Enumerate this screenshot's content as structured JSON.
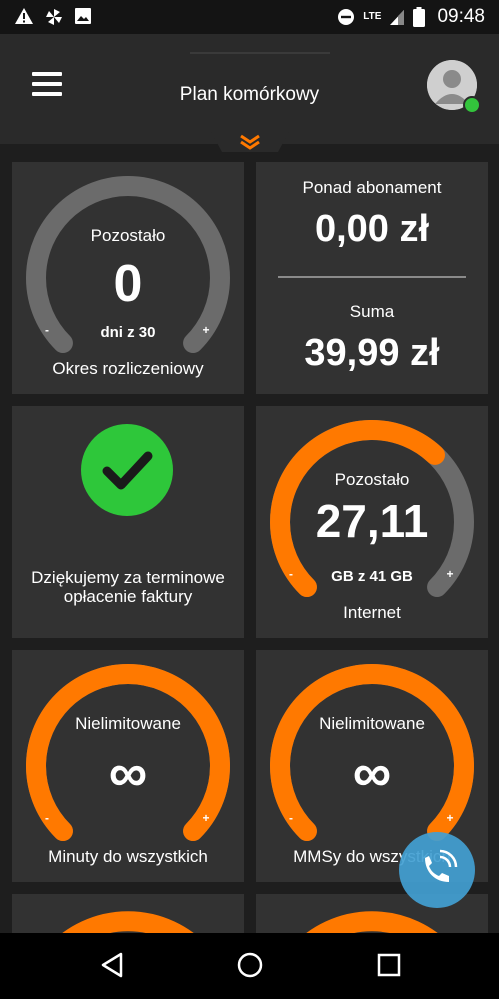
{
  "status_bar": {
    "time": "09:48",
    "network": "LTE",
    "icons": [
      "warning-icon",
      "pinwheel-icon",
      "image-icon",
      "do-not-disturb-icon",
      "signal-icon",
      "battery-icon"
    ]
  },
  "header": {
    "title": "Plan komórkowy",
    "menu_icon": "hamburger-menu-icon",
    "avatar_icon": "user-avatar-icon",
    "expand_icon": "double-chevron-down-icon"
  },
  "cards": {
    "billing": {
      "label": "Pozostało",
      "value": "0",
      "sub": "dni z 30",
      "caption": "Okres rozliczeniowy",
      "minus": "-",
      "plus": "+",
      "remaining_fraction": 0
    },
    "summary": {
      "over_title": "Ponad abonament",
      "over_value": "0,00 zł",
      "total_title": "Suma",
      "total_value": "39,99 zł"
    },
    "payment": {
      "icon": "checkmark-icon",
      "message": "Dziękujemy za terminowe opłacenie faktury"
    },
    "internet": {
      "label": "Pozostało",
      "value": "27,11",
      "sub": "GB z 41 GB",
      "caption": "Internet",
      "minus": "-",
      "plus": "+",
      "remaining_fraction": 0.66
    },
    "minutes": {
      "label": "Nielimitowane",
      "value": "∞",
      "caption": "Minuty do wszystkich",
      "minus": "-",
      "plus": "+",
      "remaining_fraction": 1
    },
    "mms": {
      "label": "Nielimitowane",
      "value": "∞",
      "caption": "MMSy do wszystkich",
      "minus": "-",
      "plus": "+",
      "remaining_fraction": 1
    }
  },
  "fab": {
    "icon": "phone-call-icon"
  },
  "nav_bar": {
    "icons": [
      "back-icon",
      "home-icon",
      "recents-icon"
    ]
  },
  "colors": {
    "accent": "#ff7900",
    "gauge_track": "#6b6b6b",
    "success": "#2ec73a",
    "card_bg": "#323232",
    "background": "#1e1e1e",
    "fab": "#42a0d2"
  }
}
